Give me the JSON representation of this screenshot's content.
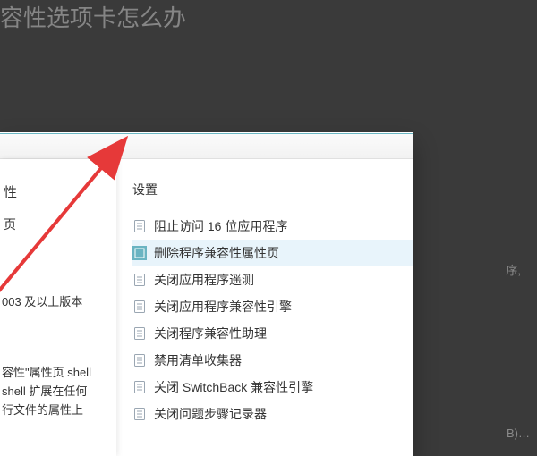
{
  "top_hint": "容性选项卡怎么办",
  "side_text_1": "序,",
  "side_text_2": "B)…",
  "left": {
    "title": "性",
    "sub": "页",
    "desc": "003 及以上版本",
    "desc2_l1": "容性\"属性页 shell",
    "desc2_l2": "shell 扩展在任何",
    "desc2_l3": "行文件的属性上"
  },
  "settings": {
    "title": "设置",
    "items": [
      {
        "label": "阻止访问 16 位应用程序",
        "highlighted": false
      },
      {
        "label": "删除程序兼容性属性页",
        "highlighted": true
      },
      {
        "label": "关闭应用程序遥测",
        "highlighted": false
      },
      {
        "label": "关闭应用程序兼容性引擎",
        "highlighted": false
      },
      {
        "label": "关闭程序兼容性助理",
        "highlighted": false
      },
      {
        "label": "禁用清单收集器",
        "highlighted": false
      },
      {
        "label": "关闭 SwitchBack 兼容性引擎",
        "highlighted": false
      },
      {
        "label": "关闭问题步骤记录器",
        "highlighted": false
      }
    ]
  }
}
